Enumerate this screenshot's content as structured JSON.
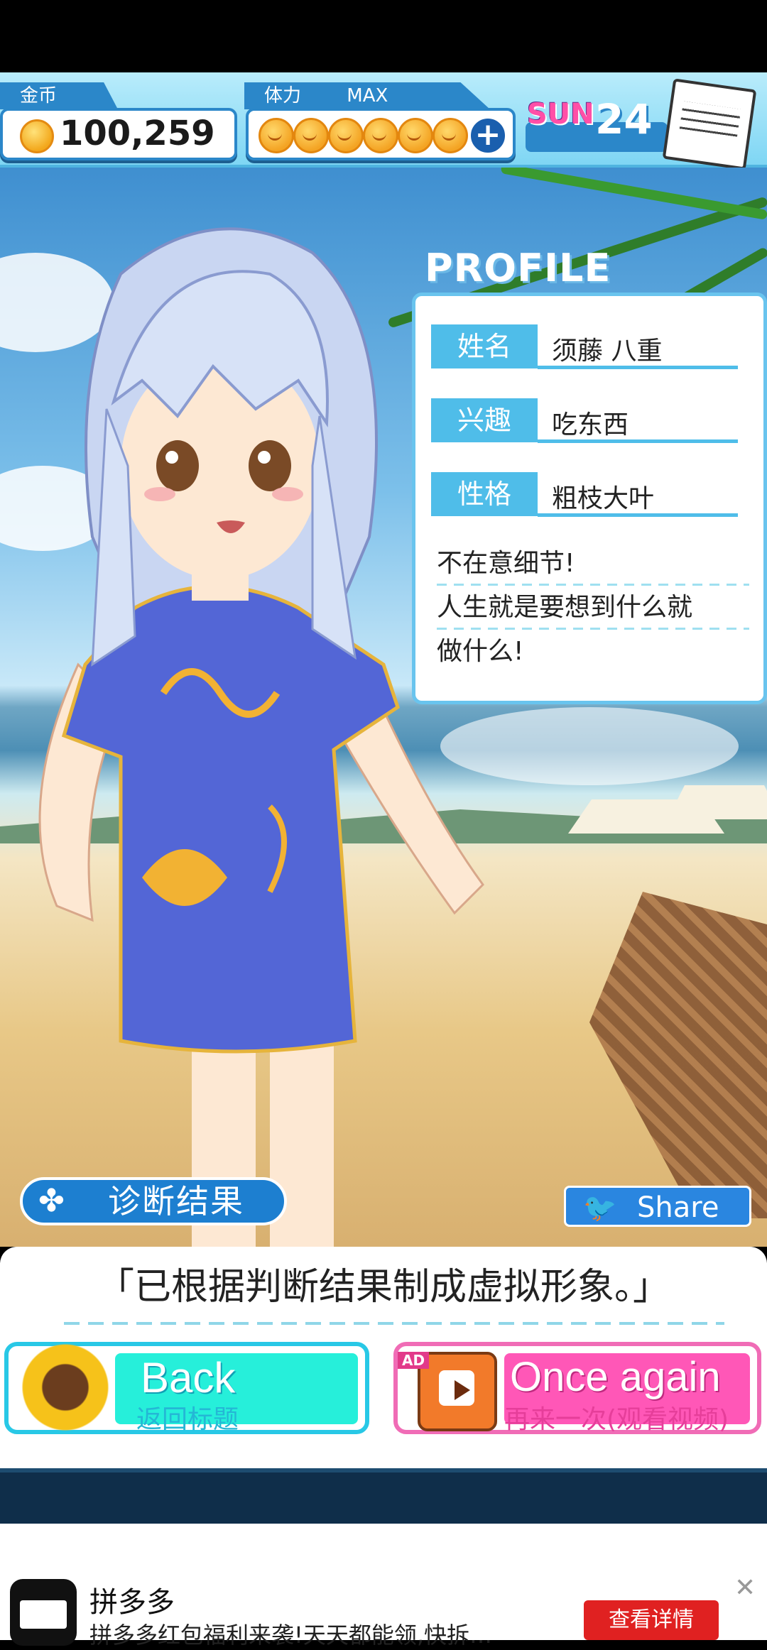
{
  "hud": {
    "coins_label": "金币",
    "coins_value": "100,259",
    "stamina_label": "体力",
    "stamina_status": "MAX",
    "stamina_count": 6,
    "day": "SUN",
    "date": "24"
  },
  "profile": {
    "heading": "PROFILE",
    "rows": [
      {
        "label": "姓名",
        "value": "须藤 八重"
      },
      {
        "label": "兴趣",
        "value": "吃东西"
      },
      {
        "label": "性格",
        "value": "粗枝大叶"
      }
    ],
    "description": [
      "不在意细节!",
      "人生就是要想到什么就",
      "做什么!"
    ]
  },
  "result": {
    "diagnosis_label": "诊断结果",
    "share_label": "Share",
    "message": "「已根据判断结果制成虚拟形象。」"
  },
  "buttons": {
    "back_title": "Back",
    "back_sub": "返回标题",
    "again_title": "Once again",
    "again_sub": "再来一次(观看视频)",
    "ad_badge": "AD"
  },
  "ad": {
    "title": "拼多多",
    "desc": "拼多多红包福利来袭!天天都能领,快拆…",
    "cta": "查看详情",
    "close": "✕"
  },
  "colors": {
    "accent_blue": "#4fbde9",
    "back_cyan": "#26efda",
    "again_pink": "#ff57b7"
  }
}
